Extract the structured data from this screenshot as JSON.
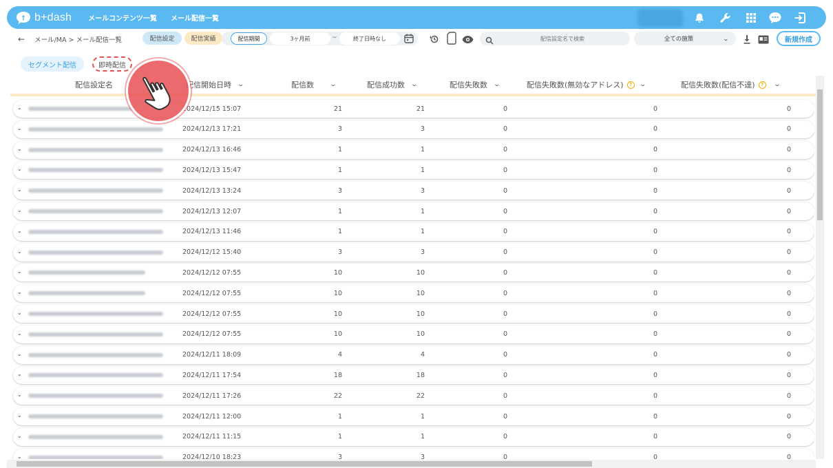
{
  "app": {
    "logo_text": "b+dash",
    "nav": [
      "メールコンテンツ一覧",
      "メール配信一覧"
    ]
  },
  "icons": [
    "bell-icon",
    "wrench-icon",
    "grid-icon",
    "chat-icon",
    "logout-icon",
    "back-arrow-icon",
    "calendar-icon",
    "history-icon",
    "device-icon",
    "eye-icon",
    "search-icon",
    "download-icon",
    "card-icon",
    "chevron-down-icon",
    "help-icon",
    "hand-pointer-icon"
  ],
  "toolbar": {
    "back": "←",
    "breadcrumb": "メール/MA > メール配信一覧",
    "tab_settings": "配信設定",
    "tab_results": "配信実績",
    "period_label": "配信期間",
    "date_from": "3ヶ月前",
    "date_sep": "~",
    "date_to": "終了日時なし",
    "search_placeholder": "配信設定名で検索",
    "select_value": "全ての施策",
    "new_button": "新規作成"
  },
  "subtabs": {
    "segment": "セグメント配信",
    "instant": "即時配信"
  },
  "table": {
    "headers": [
      "配信設定名",
      "配信開始日時",
      "配信数",
      "配信成功数",
      "配信失敗数",
      "配信失敗数(無効なアドレス)",
      "配信失敗数(配信不達)"
    ],
    "rows": [
      {
        "date": "2024/12/15 15:07",
        "sent": "21",
        "success": "21",
        "fail": "0",
        "invalid": "0",
        "undelivered": "0"
      },
      {
        "date": "2024/12/13 17:21",
        "sent": "3",
        "success": "3",
        "fail": "0",
        "invalid": "0",
        "undelivered": "0"
      },
      {
        "date": "2024/12/13 16:46",
        "sent": "1",
        "success": "1",
        "fail": "0",
        "invalid": "0",
        "undelivered": "0"
      },
      {
        "date": "2024/12/13 15:47",
        "sent": "1",
        "success": "1",
        "fail": "0",
        "invalid": "0",
        "undelivered": "0"
      },
      {
        "date": "2024/12/13 13:24",
        "sent": "3",
        "success": "3",
        "fail": "0",
        "invalid": "0",
        "undelivered": "0"
      },
      {
        "date": "2024/12/13 12:07",
        "sent": "1",
        "success": "1",
        "fail": "0",
        "invalid": "0",
        "undelivered": "0"
      },
      {
        "date": "2024/12/13 11:46",
        "sent": "1",
        "success": "1",
        "fail": "0",
        "invalid": "0",
        "undelivered": "0"
      },
      {
        "date": "2024/12/12 15:40",
        "sent": "3",
        "success": "3",
        "fail": "0",
        "invalid": "0",
        "undelivered": "0"
      },
      {
        "date": "2024/12/12 07:55",
        "sent": "10",
        "success": "10",
        "fail": "0",
        "invalid": "0",
        "undelivered": "0"
      },
      {
        "date": "2024/12/12 07:55",
        "sent": "10",
        "success": "10",
        "fail": "0",
        "invalid": "0",
        "undelivered": "0"
      },
      {
        "date": "2024/12/12 07:55",
        "sent": "10",
        "success": "10",
        "fail": "0",
        "invalid": "0",
        "undelivered": "0"
      },
      {
        "date": "2024/12/12 07:55",
        "sent": "10",
        "success": "10",
        "fail": "0",
        "invalid": "0",
        "undelivered": "0"
      },
      {
        "date": "2024/12/11 18:09",
        "sent": "4",
        "success": "4",
        "fail": "0",
        "invalid": "0",
        "undelivered": "0"
      },
      {
        "date": "2024/12/11 17:54",
        "sent": "18",
        "success": "18",
        "fail": "0",
        "invalid": "0",
        "undelivered": "0"
      },
      {
        "date": "2024/12/11 17:26",
        "sent": "22",
        "success": "22",
        "fail": "0",
        "invalid": "0",
        "undelivered": "0"
      },
      {
        "date": "2024/12/11 12:00",
        "sent": "1",
        "success": "1",
        "fail": "0",
        "invalid": "0",
        "undelivered": "0"
      },
      {
        "date": "2024/12/11 11:15",
        "sent": "1",
        "success": "1",
        "fail": "0",
        "invalid": "0",
        "undelivered": "0"
      },
      {
        "date": "2024/12/10 18:23",
        "sent": "3",
        "success": "3",
        "fail": "0",
        "invalid": "0",
        "undelivered": "0"
      }
    ]
  }
}
